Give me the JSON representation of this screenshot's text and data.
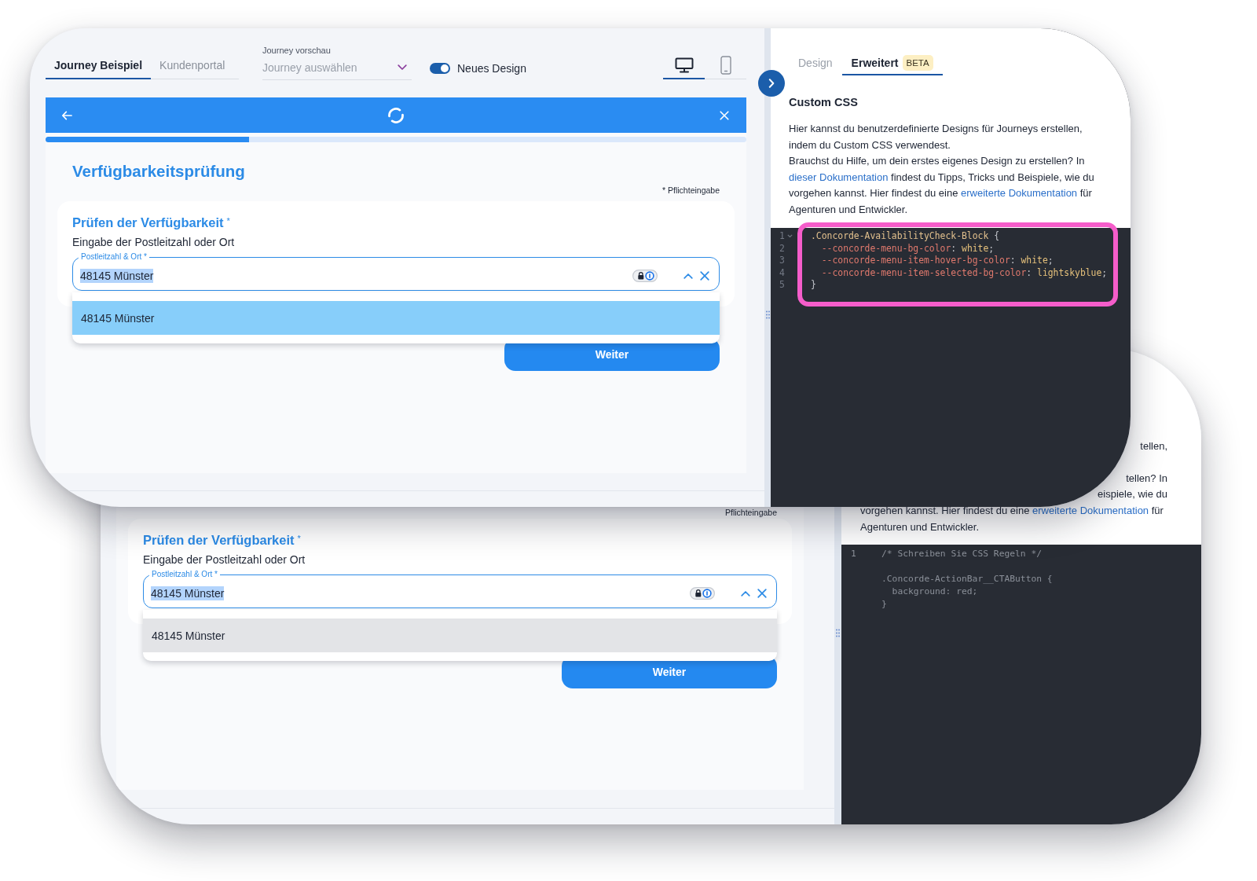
{
  "front_window": {
    "tabs": [
      {
        "label": "Journey Beispiel",
        "selected": true
      },
      {
        "label": "Kundenportal",
        "selected": false
      }
    ],
    "journey_select": {
      "label": "Journey vorschau",
      "placeholder": "Journey auswählen"
    },
    "design_toggle": {
      "label": "Neues Design",
      "on": true
    },
    "device_tabs": [
      {
        "kind": "desktop",
        "selected": true
      },
      {
        "kind": "mobile",
        "selected": false
      }
    ],
    "preview": {
      "progress": {
        "level": 0.29
      },
      "title": "Verfügbarkeitsprüfung",
      "required_note": "* Pflichteingabe",
      "form": {
        "title": "Prüfen der Verfügbarkeit",
        "required_mark": "*",
        "description": "Eingabe der Postleitzahl oder Ort",
        "field": {
          "label": "Postleitzahl & Ort *",
          "value": "48145 Münster",
          "value_selected": true
        },
        "options": [
          {
            "label": "48145 Münster",
            "selected": true
          }
        ],
        "button": "Weiter"
      }
    },
    "settings": {
      "tabs": [
        {
          "label": "Design",
          "selected": false
        },
        {
          "label": "Erweitert",
          "selected": true,
          "badge": "BETA"
        }
      ],
      "heading": "Custom CSS",
      "paragraphs": [
        [
          {
            "kind": "text",
            "text": "Hier kannst du benutzerdefinierte Designs für Journeys erstellen, indem du Custom CSS verwendest."
          }
        ],
        [
          {
            "kind": "text",
            "text": "Brauchst du Hilfe, um dein erstes eigenes Design zu erstellen? In "
          },
          {
            "kind": "link",
            "text": "dieser Dokumentation"
          },
          {
            "kind": "text",
            "text": " findest du Tipps, Tricks und Beispiele, wie du vorgehen kannst. Hier findest du eine "
          },
          {
            "kind": "link",
            "text": "erweiterte Dokumentation"
          },
          {
            "kind": "text",
            "text": " für Agenturen und Entwickler."
          }
        ]
      ],
      "code": {
        "highlighted": true,
        "lines": [
          {
            "number": "1",
            "foldable": true,
            "tokens": [
              {
                "kind": "selector",
                "text": ".Concorde-AvailabilityCheck-Block"
              },
              {
                "kind": "punct",
                "text": " {"
              }
            ]
          },
          {
            "number": "2",
            "foldable": false,
            "tokens": [
              {
                "kind": "property",
                "text": "  --concorde-menu-bg-color"
              },
              {
                "kind": "punct",
                "text": ": "
              },
              {
                "kind": "value",
                "text": "white"
              },
              {
                "kind": "punct",
                "text": ";"
              }
            ]
          },
          {
            "number": "3",
            "foldable": false,
            "tokens": [
              {
                "kind": "property",
                "text": "  --concorde-menu-item-hover-bg-color"
              },
              {
                "kind": "punct",
                "text": ": "
              },
              {
                "kind": "value",
                "text": "white"
              },
              {
                "kind": "punct",
                "text": ";"
              }
            ]
          },
          {
            "number": "4",
            "foldable": false,
            "tokens": [
              {
                "kind": "property",
                "text": "  --concorde-menu-item-selected-bg-color"
              },
              {
                "kind": "punct",
                "text": ": "
              },
              {
                "kind": "value",
                "text": "lightskyblue"
              },
              {
                "kind": "punct",
                "text": ";"
              }
            ]
          },
          {
            "number": "5",
            "foldable": false,
            "tokens": [
              {
                "kind": "punct",
                "text": "}"
              }
            ]
          }
        ]
      }
    }
  },
  "back_window": {
    "preview": {
      "required_note": "Pflichteingabe",
      "form": {
        "title": "Prüfen der Verfügbarkeit",
        "required_mark": "*",
        "description": "Eingabe der Postleitzahl oder Ort",
        "field": {
          "label": "Postleitzahl & Ort *",
          "value": "48145 Münster",
          "value_selected": true
        },
        "options": [
          {
            "label": "48145 Münster",
            "selected": true
          }
        ],
        "button": "Weiter"
      }
    },
    "settings": {
      "text_lines": [
        {
          "kind": "fragment",
          "segments": [
            {
              "kind": "text",
              "text": "tellen,"
            }
          ]
        },
        {
          "kind": "fragment",
          "segments": [
            {
              "kind": "text",
              "text": "tellen? In"
            }
          ]
        },
        {
          "kind": "fragment",
          "segments": [
            {
              "kind": "text",
              "text": "eispiele, wie du"
            }
          ]
        },
        {
          "kind": "line",
          "segments": [
            {
              "kind": "text",
              "text": "vorgehen kannst. Hier findest du eine "
            },
            {
              "kind": "link",
              "text": "erweiterte Dokumentation"
            },
            {
              "kind": "text",
              "text": " für"
            }
          ]
        },
        {
          "kind": "line",
          "segments": [
            {
              "kind": "text",
              "text": "Agenturen und Entwickler."
            }
          ]
        }
      ],
      "code": {
        "line_numbers": [
          "1"
        ],
        "text": "/* Schreiben Sie CSS Regeln */\n\n.Concorde-ActionBar__CTAButton {\n  background: red;\n}"
      }
    }
  }
}
